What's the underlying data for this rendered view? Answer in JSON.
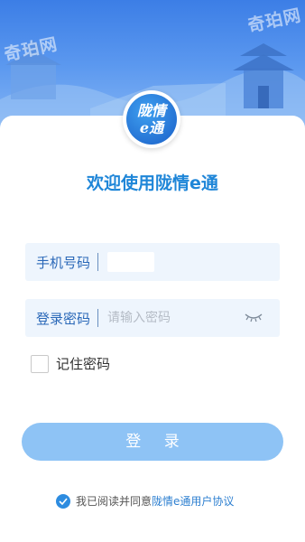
{
  "header": {
    "watermarks": [
      "奇珀网",
      "奇珀网"
    ],
    "logo_line1": "陇情",
    "logo_line2": "e通"
  },
  "welcome_title": "欢迎使用陇情e通",
  "form": {
    "phone_label": "手机号码",
    "password_label": "登录密码",
    "password_placeholder": "请输入密码",
    "eye_icon": "eye-closed-icon",
    "remember_label": "记住密码"
  },
  "login_button": "登 录",
  "agreement": {
    "prefix": "我已阅读并同意",
    "link": "陇情e通用户协议"
  },
  "colors": {
    "accent": "#1f86d8",
    "button": "#8ec3f5",
    "field_bg": "#eef5fd"
  }
}
